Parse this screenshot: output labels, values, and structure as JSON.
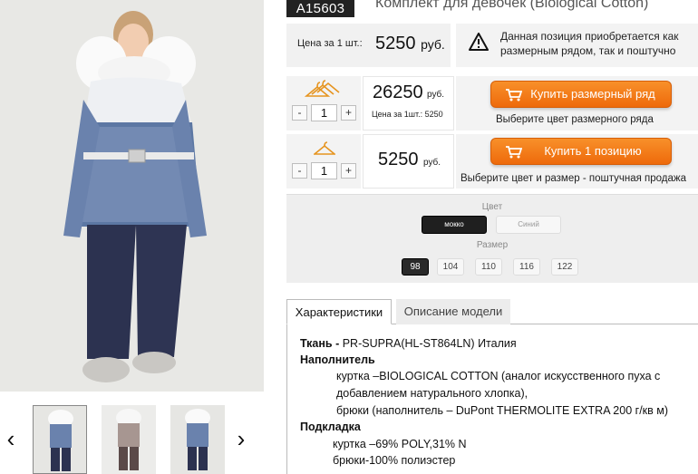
{
  "product": {
    "sku": "A15603",
    "title": "Комплект для девочек (Biological Cotton)"
  },
  "price_unit": {
    "label": "Цена за 1 шт.:",
    "value": "5250",
    "currency": "руб."
  },
  "notice": {
    "text": "Данная позиция приобретается как размерным рядом, так и поштучно"
  },
  "size_row_purchase": {
    "qty": "1",
    "total": "26250",
    "currency": "руб.",
    "unit_note": "Цена за 1шт.: 5250",
    "button_label": "Купить размерный ряд",
    "hint": "Выберите цвет размерного ряда"
  },
  "single_purchase": {
    "qty": "1",
    "total": "5250",
    "currency": "руб.",
    "button_label": "Купить 1 позицию",
    "hint": "Выберите цвет и размер - поштучная продажа"
  },
  "options": {
    "color_label": "Цвет",
    "colors": [
      {
        "label": "мокко",
        "selected": true
      },
      {
        "label": "Синий",
        "selected": false
      }
    ],
    "size_label": "Размер",
    "sizes": [
      {
        "label": "98",
        "selected": true
      },
      {
        "label": "104",
        "selected": false
      },
      {
        "label": "110",
        "selected": false
      },
      {
        "label": "116",
        "selected": false
      },
      {
        "label": "122",
        "selected": false
      }
    ]
  },
  "tabs": [
    {
      "label": "Характеристики",
      "active": true
    },
    {
      "label": "Описание модели",
      "active": false
    }
  ],
  "specs": {
    "fabric_key": "Ткань -",
    "fabric_val": " PR-SUPRA(HL-ST864LN) Италия",
    "filler_title": "Наполнитель",
    "filler_l1": "куртка –BIOLOGICAL COTTON (аналог искусственного пуха с",
    "filler_l2": "добавлением натурального хлопка),",
    "filler_l3": "брюки (наполнитель – DuPont THERMOLITE EXTRA 200 г/кв м)",
    "lining_title": "Подкладка",
    "lining_l1": "куртка –69% POLY,31% N",
    "lining_l2": "брюки-100% полиэстер"
  },
  "colors": {
    "accent": "#f07a14",
    "dark": "#222222"
  }
}
